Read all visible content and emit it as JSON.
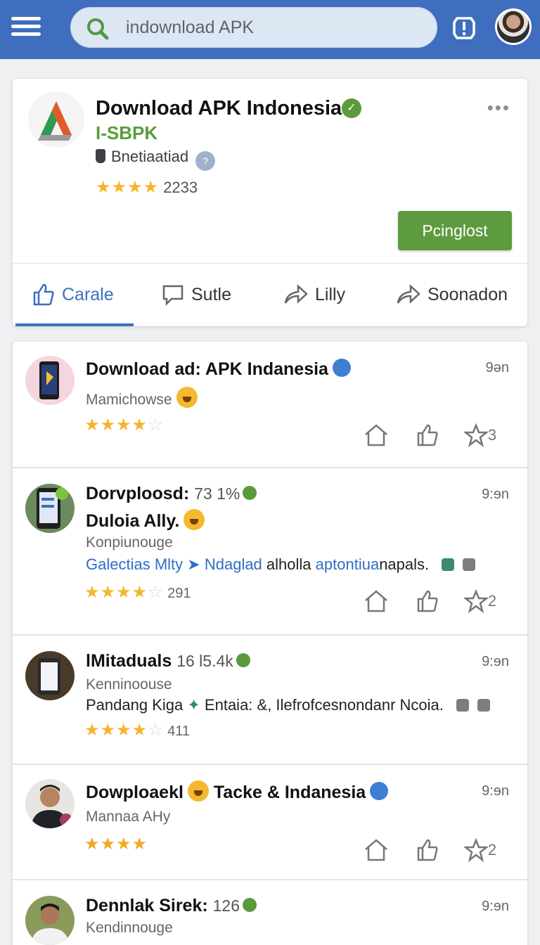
{
  "topbar": {
    "search_text": "indownload APK"
  },
  "featured": {
    "title": "Download APK Indonesia",
    "subtitle": "I-SBPK",
    "developer": "Bnetiaatiad",
    "rating_count": "2233",
    "install_label": "Pcinglost",
    "more": "•••"
  },
  "tabs": [
    {
      "label": "Carale"
    },
    {
      "label": "Sutle"
    },
    {
      "label": "Lilly"
    },
    {
      "label": "Soonadon"
    }
  ],
  "posts": [
    {
      "title": "Download ad: APK Indanesia",
      "time": "9ən",
      "line1": "Mamichowse",
      "like_count": "3"
    },
    {
      "title": "Dorvploosd:",
      "count": "73 1%",
      "time": "9:ɘn",
      "title2": "Duloia Ally.",
      "line1": "Konpiunouge",
      "line2_blue1": "Galectias Mlty",
      "line2_blue2": "Ndaglad",
      "line2_rest": "alholla",
      "line2_blue3": "aptontiua",
      "line2_end": "napals.",
      "rating_count": "291",
      "like_count": "2"
    },
    {
      "title": "lMitaduals",
      "count": "16 l5.4k",
      "time": "9:ɘn",
      "line1": "Kenninoouse",
      "line2": "Pandang Kiga",
      "line2b": "Entaia: &, Ilefrofcesnondanr Ncoia.",
      "rating_count": "411"
    },
    {
      "title": "Dowploaekl",
      "title_b": "Tacke & Indanesia",
      "time": "9:ɘn",
      "line1": "Mannaa AHy",
      "like_count": "2"
    },
    {
      "title": "Dennlak Sirek:",
      "count": "126",
      "time": "9:ɘn",
      "line1": "Kendinnouge"
    }
  ]
}
